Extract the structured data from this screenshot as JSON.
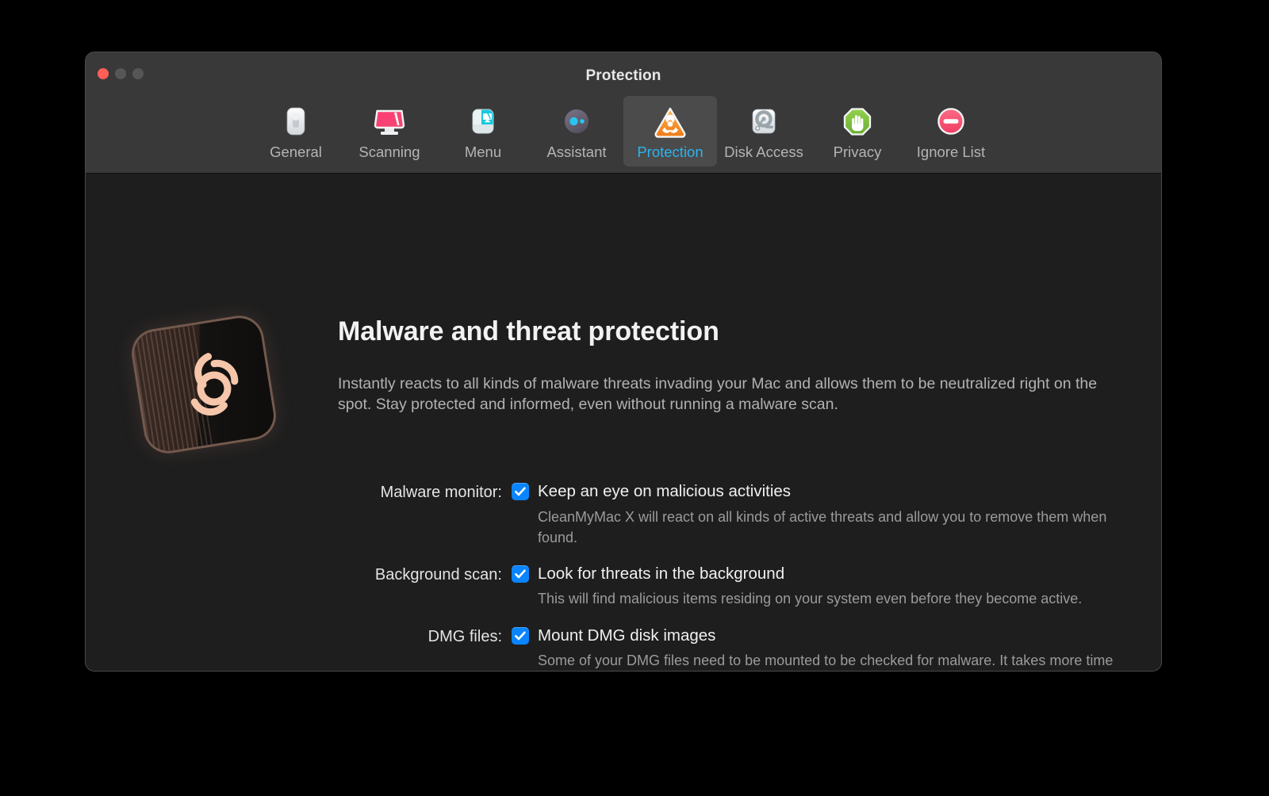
{
  "window": {
    "title": "Protection",
    "traffic_lights": [
      "close",
      "minimize",
      "maximize"
    ]
  },
  "toolbar": {
    "tabs": [
      {
        "label": "General",
        "icon": "general-icon",
        "selected": false
      },
      {
        "label": "Scanning",
        "icon": "scanning-icon",
        "selected": false
      },
      {
        "label": "Menu",
        "icon": "menu-icon",
        "selected": false
      },
      {
        "label": "Assistant",
        "icon": "assistant-icon",
        "selected": false
      },
      {
        "label": "Protection",
        "icon": "protection-icon",
        "selected": true
      },
      {
        "label": "Disk Access",
        "icon": "disk-access-icon",
        "selected": false
      },
      {
        "label": "Privacy",
        "icon": "privacy-icon",
        "selected": false
      },
      {
        "label": "Ignore List",
        "icon": "ignore-list-icon",
        "selected": false
      }
    ]
  },
  "main": {
    "hero_icon": "malware-protection-biohazard-illustration",
    "headline": "Malware and threat protection",
    "description": "Instantly reacts to all kinds of malware threats invading your Mac and allows them to be neutralized right on the spot. Stay protected and informed, even without running a malware scan.",
    "options": [
      {
        "label": "Malware monitor:",
        "checkbox_label": "Keep an eye on malicious activities",
        "checked": true,
        "hint": "CleanMyMac X will react on all kinds of active threats and allow you to remove them when found."
      },
      {
        "label": "Background scan:",
        "checkbox_label": "Look for threats in the background",
        "checked": true,
        "hint": "This will find malicious items residing on your system even before they become active."
      },
      {
        "label": "DMG files:",
        "checkbox_label": "Mount DMG disk images",
        "checked": true,
        "hint": "Some of your DMG files need to be mounted to be checked for malware. It takes more time and may interrupt your scan. Ignore them for faster scans, keeping the risks in mind."
      }
    ]
  },
  "colors": {
    "accent_selected_tab_text": "#2bb4ef",
    "checkbox_blue": "#0a84ff",
    "toolbar_bg": "#393939",
    "content_bg": "#1e1e1e",
    "close_button": "#ff5f57",
    "protection_icon_orange": "#f0841e",
    "privacy_icon_green": "#7cc242",
    "ignore_icon_pink": "#f4546e",
    "scanning_icon_pink": "#fb3b6e",
    "menu_icon_cyan": "#18c8e0",
    "hero_biohazard": "#f5c4a8"
  }
}
